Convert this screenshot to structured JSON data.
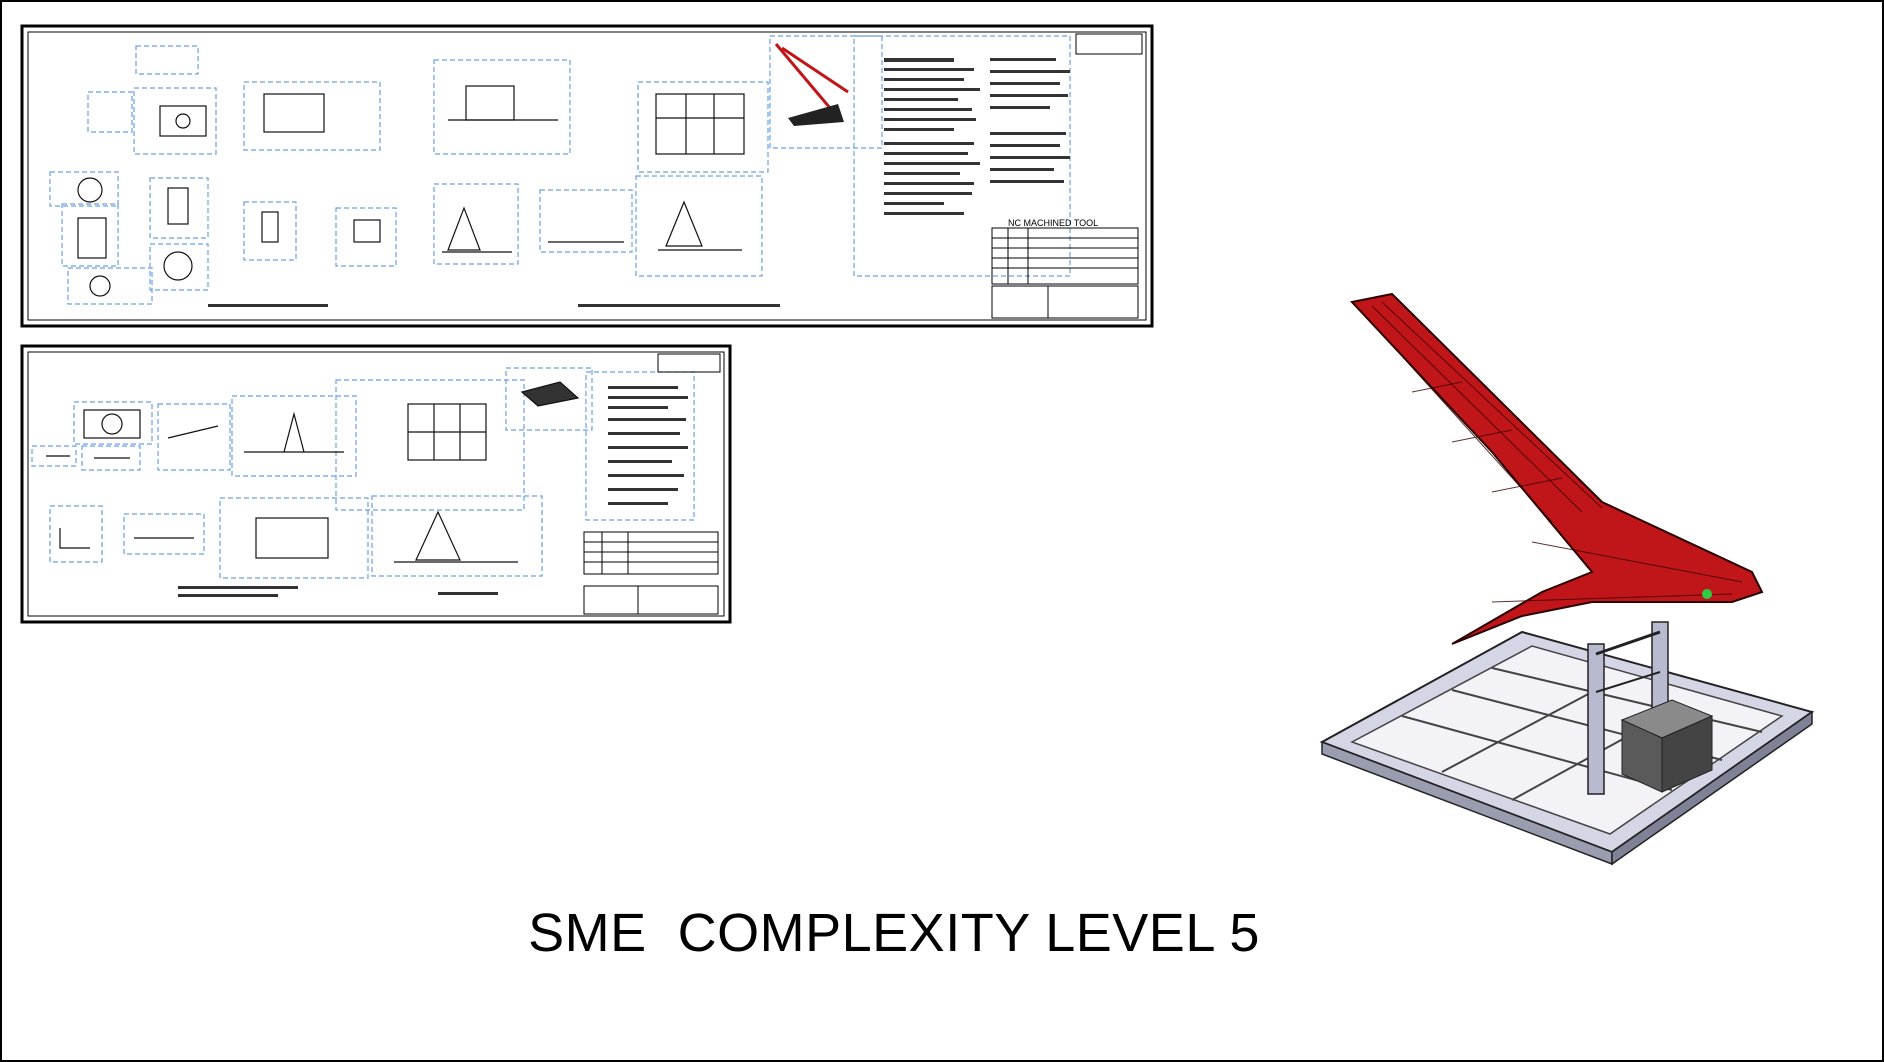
{
  "slide": {
    "caption": "SME  COMPLEXITY LEVEL 5"
  },
  "drawings": [
    {
      "name": "engineering-drawing-sheet-1",
      "callout": "NC MACHINED TOOL"
    },
    {
      "name": "engineering-drawing-sheet-2"
    }
  ],
  "model": {
    "part_color": "#c0161a",
    "fixture_color": "#c9cbe0"
  }
}
